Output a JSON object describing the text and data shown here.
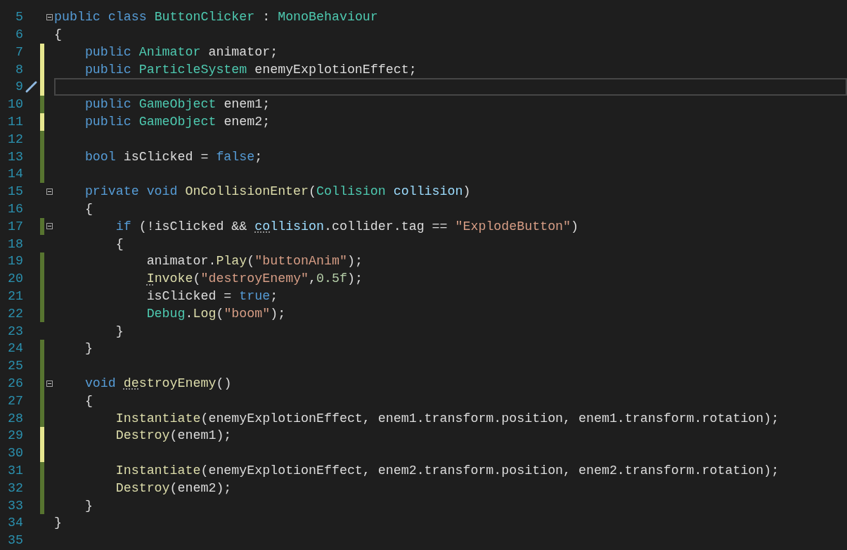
{
  "editor": {
    "lines": [
      {
        "number": "5",
        "fold": true,
        "current": false,
        "tokens": [
          {
            "text": "public class",
            "kind": "kw"
          },
          {
            "text": " ButtonClicker",
            "kind": "type"
          },
          {
            "text": " : ",
            "kind": "plain"
          },
          {
            "text": "MonoBehaviour",
            "kind": "type"
          }
        ]
      },
      {
        "number": "6",
        "fold": false,
        "current": false,
        "tokens": [
          {
            "text": "{",
            "kind": "plain"
          }
        ]
      },
      {
        "number": "7",
        "color": "#e6e68f",
        "fold": false,
        "current": false,
        "tokens": [
          {
            "text": "    public",
            "kind": "kw"
          },
          {
            "text": " Animator",
            "kind": "type"
          },
          {
            "text": " animator;",
            "kind": "plain"
          }
        ]
      },
      {
        "number": "8",
        "color": "#e6e68f",
        "fold": false,
        "current": false,
        "tokens": [
          {
            "text": "    public",
            "kind": "kw"
          },
          {
            "text": " ParticleSystem",
            "kind": "type"
          },
          {
            "text": " enemyExplotionEffect;",
            "kind": "plain"
          }
        ]
      },
      {
        "number": "9",
        "color": "#e6e68f",
        "fold": false,
        "current": true
      },
      {
        "number": "10",
        "color": "#577430",
        "fold": false,
        "current": false,
        "tokens": [
          {
            "text": "    public",
            "kind": "kw"
          },
          {
            "text": " GameObject",
            "kind": "type"
          },
          {
            "text": " enem1;",
            "kind": "plain"
          }
        ]
      },
      {
        "number": "11",
        "color": "#e6e68f",
        "fold": false,
        "current": false,
        "tokens": [
          {
            "text": "    public",
            "kind": "kw"
          },
          {
            "text": " GameObject",
            "kind": "type"
          },
          {
            "text": " enem2;",
            "kind": "plain"
          }
        ]
      },
      {
        "number": "12",
        "color": "#577430",
        "fold": false,
        "current": false
      },
      {
        "number": "13",
        "color": "#577430",
        "fold": false,
        "current": false,
        "tokens": [
          {
            "text": "    bool",
            "kind": "kw"
          },
          {
            "text": " isClicked = ",
            "kind": "plain"
          },
          {
            "text": "false",
            "kind": "kw"
          },
          {
            "text": ";",
            "kind": "plain"
          }
        ]
      },
      {
        "number": "14",
        "color": "#577430",
        "fold": false,
        "current": false
      },
      {
        "number": "15",
        "fold": true,
        "current": false,
        "tokens": [
          {
            "text": "    private void",
            "kind": "kw"
          },
          {
            "text": " OnCollisionEnter",
            "kind": "method"
          },
          {
            "text": "(",
            "kind": "plain"
          },
          {
            "text": "Collision",
            "kind": "type"
          },
          {
            "text": " collision",
            "kind": "param"
          },
          {
            "text": ")",
            "kind": "plain"
          }
        ]
      },
      {
        "number": "16",
        "fold": false,
        "current": false,
        "tokens": [
          {
            "text": "    {",
            "kind": "plain"
          }
        ]
      },
      {
        "number": "17",
        "color": "#577430",
        "fold": true,
        "current": false,
        "tokens": [
          {
            "text": "        if",
            "kind": "kw"
          },
          {
            "text": " (!isClicked && ",
            "kind": "plain"
          },
          {
            "text": "co",
            "kind": "param",
            "hint": true
          },
          {
            "text": "llision",
            "kind": "param"
          },
          {
            "text": ".collider.tag == ",
            "kind": "plain"
          },
          {
            "text": "\"ExplodeButton\"",
            "kind": "str"
          },
          {
            "text": ")",
            "kind": "plain"
          }
        ]
      },
      {
        "number": "18",
        "fold": false,
        "current": false,
        "tokens": [
          {
            "text": "        {",
            "kind": "plain"
          }
        ]
      },
      {
        "number": "19",
        "color": "#577430",
        "fold": false,
        "current": false,
        "tokens": [
          {
            "text": "            animator.",
            "kind": "plain"
          },
          {
            "text": "Play",
            "kind": "method"
          },
          {
            "text": "(",
            "kind": "plain"
          },
          {
            "text": "\"buttonAnim\"",
            "kind": "str"
          },
          {
            "text": ");",
            "kind": "plain"
          }
        ]
      },
      {
        "number": "20",
        "color": "#577430",
        "fold": false,
        "current": false,
        "tokens": [
          {
            "text": "            I",
            "kind": "method",
            "hint": true
          },
          {
            "text": "nvoke",
            "kind": "method"
          },
          {
            "text": "(",
            "kind": "plain"
          },
          {
            "text": "\"destroyEnemy\"",
            "kind": "str"
          },
          {
            "text": ",",
            "kind": "plain"
          },
          {
            "text": "0.5f",
            "kind": "num"
          },
          {
            "text": ");",
            "kind": "plain"
          }
        ]
      },
      {
        "number": "21",
        "color": "#577430",
        "fold": false,
        "current": false,
        "tokens": [
          {
            "text": "            isClicked = ",
            "kind": "plain"
          },
          {
            "text": "true",
            "kind": "kw"
          },
          {
            "text": ";",
            "kind": "plain"
          }
        ]
      },
      {
        "number": "22",
        "color": "#577430",
        "fold": false,
        "current": false,
        "tokens": [
          {
            "text": "            Debug",
            "kind": "type"
          },
          {
            "text": ".",
            "kind": "plain"
          },
          {
            "text": "Log",
            "kind": "method"
          },
          {
            "text": "(",
            "kind": "plain"
          },
          {
            "text": "\"boom\"",
            "kind": "str"
          },
          {
            "text": ");",
            "kind": "plain"
          }
        ]
      },
      {
        "number": "23",
        "fold": false,
        "current": false,
        "tokens": [
          {
            "text": "        }",
            "kind": "plain"
          }
        ]
      },
      {
        "number": "24",
        "color": "#577430",
        "fold": false,
        "current": false,
        "tokens": [
          {
            "text": "    }",
            "kind": "plain"
          }
        ]
      },
      {
        "number": "25",
        "color": "#577430",
        "fold": false,
        "current": false
      },
      {
        "number": "26",
        "color": "#577430",
        "fold": true,
        "current": false,
        "tokens": [
          {
            "text": "    void",
            "kind": "kw"
          },
          {
            "text": " de",
            "kind": "method",
            "hint": true
          },
          {
            "text": "stroyEnemy",
            "kind": "method"
          },
          {
            "text": "()",
            "kind": "plain"
          }
        ]
      },
      {
        "number": "27",
        "color": "#577430",
        "fold": false,
        "current": false,
        "tokens": [
          {
            "text": "    {",
            "kind": "plain"
          }
        ]
      },
      {
        "number": "28",
        "color": "#577430",
        "fold": false,
        "current": false,
        "tokens": [
          {
            "text": "        Instantiate",
            "kind": "method"
          },
          {
            "text": "(enemyExplotionEffect, enem1.transform.position, enem1.transform.rotation);",
            "kind": "plain"
          }
        ]
      },
      {
        "number": "29",
        "color": "#e6e68f",
        "fold": false,
        "current": false,
        "tokens": [
          {
            "text": "        Destroy",
            "kind": "method"
          },
          {
            "text": "(enem1);",
            "kind": "plain"
          }
        ]
      },
      {
        "number": "30",
        "color": "#e6e68f",
        "fold": false,
        "current": false
      },
      {
        "number": "31",
        "color": "#577430",
        "fold": false,
        "current": false,
        "tokens": [
          {
            "text": "        Instantiate",
            "kind": "method"
          },
          {
            "text": "(enemyExplotionEffect, enem2.transform.position, enem2.transform.rotation);",
            "kind": "plain"
          }
        ]
      },
      {
        "number": "32",
        "color": "#577430",
        "fold": false,
        "current": false,
        "tokens": [
          {
            "text": "        Destroy",
            "kind": "method"
          },
          {
            "text": "(enem2);",
            "kind": "plain"
          }
        ]
      },
      {
        "number": "33",
        "color": "#577430",
        "fold": false,
        "current": false,
        "tokens": [
          {
            "text": "    }",
            "kind": "plain"
          }
        ]
      },
      {
        "number": "34",
        "fold": false,
        "current": false,
        "tokens": [
          {
            "text": "}",
            "kind": "plain"
          }
        ]
      },
      {
        "number": "35",
        "fold": false,
        "current": false
      }
    ]
  }
}
